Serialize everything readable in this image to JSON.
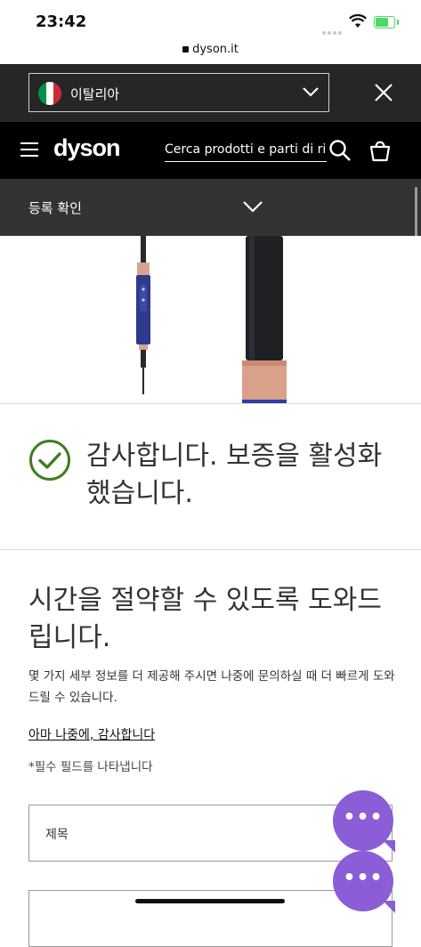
{
  "status_bar": {
    "time": "23:42"
  },
  "browser": {
    "url": "dyson.it"
  },
  "country_bar": {
    "country": "이탈리아",
    "flag_colors": [
      "#009246",
      "#ffffff",
      "#ce2b37"
    ],
    "chevron_icon": "chevron-down-icon",
    "close_icon": "close-icon"
  },
  "nav": {
    "logo": "dyson",
    "search_placeholder": "Cerca prodotti e parti di ricambio",
    "menu_icon": "hamburger-icon",
    "search_icon": "search-icon",
    "bag_icon": "bag-icon"
  },
  "registration_bar": {
    "label": "등록 확인"
  },
  "confirmation": {
    "message": "감사합니다. 보증을 활성화했습니다.",
    "icon": "check-circle-icon",
    "accent_color": "#3f7d20"
  },
  "section": {
    "title": "시간을 절약할 수 있도록 도와드립니다.",
    "description": "몇 가지 세부 정보를 더 제공해 주시면 나중에 문의하실 때 더 빠르게 도와드릴 수 있습니다.",
    "later_link": "아마 나중에, 감사합니다",
    "required_note": "*필수 필드를 나타냅니다"
  },
  "form": {
    "fields": [
      {
        "label": "제목"
      },
      {
        "label": ""
      }
    ]
  },
  "chat": {
    "icon": "chat-icon",
    "dots": "•••",
    "color": "#8b5dd6"
  }
}
